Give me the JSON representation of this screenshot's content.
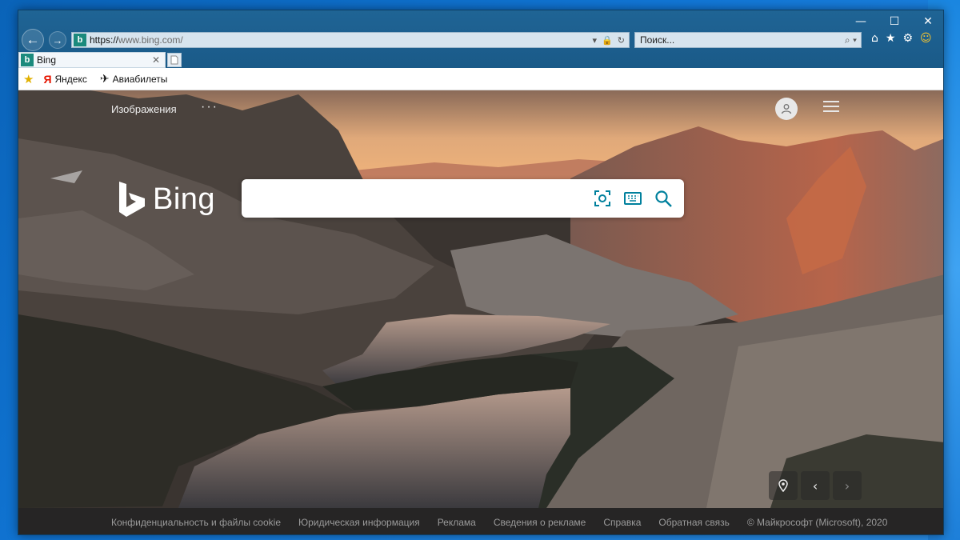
{
  "window": {
    "controls": {
      "minimize": "—",
      "maximize": "☐",
      "close": "✕"
    }
  },
  "nav": {
    "back_icon": "←",
    "forward_icon": "→"
  },
  "address": {
    "favicon": "b",
    "scheme": "https://",
    "host": "www.bing.com/",
    "tools": [
      "▾",
      "🔒",
      "↻"
    ]
  },
  "search_bar": {
    "placeholder": "Поиск...",
    "tools": "⌕ ▾"
  },
  "toolbar": {
    "home": "⌂",
    "favorites": "★",
    "settings": "⚙",
    "feedback": "☺"
  },
  "tab": {
    "favicon": "b",
    "title": "Bing",
    "close": "✕"
  },
  "favorites_bar": {
    "items": [
      {
        "icon": "ya",
        "label": "Яндекс"
      },
      {
        "icon": "plane",
        "label": "Авиабилеты"
      }
    ]
  },
  "bing": {
    "top_nav": {
      "images": "Изображения",
      "more": "···"
    },
    "logo_text": "Bing",
    "search_icons": [
      "visual-search-icon",
      "keyboard-icon",
      "search-icon"
    ],
    "image_controls": {
      "location": "⊙",
      "prev": "‹",
      "next": "›"
    },
    "footer": [
      "Конфиденциальность и файлы cookie",
      "Юридическая информация",
      "Реклама",
      "Сведения о рекламе",
      "Справка",
      "Обратная связь",
      "© Майкрософт (Microsoft), 2020"
    ]
  },
  "colors": {
    "bing_accent": "#00809d",
    "chrome": "#1b5c8c"
  }
}
